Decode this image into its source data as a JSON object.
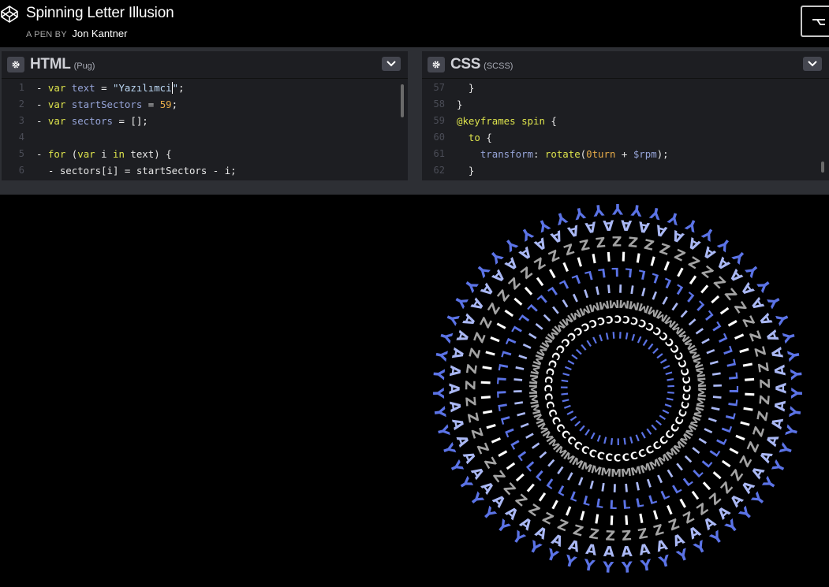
{
  "header": {
    "title": "Spinning Letter Illusion",
    "byline_prefix": "A PEN BY",
    "author": "Jon Kantner"
  },
  "editors": [
    {
      "language": "HTML",
      "preprocessor": "(Pug)",
      "lines": [
        {
          "n": "1",
          "tokens": [
            [
              "op",
              "- "
            ],
            [
              "kw",
              "var "
            ],
            [
              "var",
              "text"
            ],
            [
              "op",
              " = "
            ],
            [
              "str",
              "\"Yazılımci"
            ],
            [
              "cursor",
              ""
            ],
            [
              "str",
              "\""
            ],
            [
              "op",
              ";"
            ]
          ]
        },
        {
          "n": "2",
          "tokens": [
            [
              "op",
              "- "
            ],
            [
              "kw",
              "var "
            ],
            [
              "var",
              "startSectors"
            ],
            [
              "op",
              " = "
            ],
            [
              "num",
              "59"
            ],
            [
              "op",
              ";"
            ]
          ]
        },
        {
          "n": "3",
          "tokens": [
            [
              "op",
              "- "
            ],
            [
              "kw",
              "var "
            ],
            [
              "var",
              "sectors"
            ],
            [
              "op",
              " = [];"
            ]
          ]
        },
        {
          "n": "4",
          "tokens": []
        },
        {
          "n": "5",
          "tokens": [
            [
              "op",
              "- "
            ],
            [
              "kw",
              "for "
            ],
            [
              "op",
              "("
            ],
            [
              "kw",
              "var "
            ],
            [
              "plain",
              "i "
            ],
            [
              "kw",
              "in "
            ],
            [
              "plain",
              "text) {"
            ]
          ]
        },
        {
          "n": "6",
          "tokens": [
            [
              "op",
              "  - "
            ],
            [
              "plain",
              "sectors[i] = startSectors - i;"
            ]
          ]
        }
      ]
    },
    {
      "language": "CSS",
      "preprocessor": "(SCSS)",
      "lines": [
        {
          "n": "57",
          "tokens": [
            [
              "plain",
              "  }"
            ]
          ]
        },
        {
          "n": "58",
          "tokens": [
            [
              "plain",
              "}"
            ]
          ]
        },
        {
          "n": "59",
          "tokens": [
            [
              "at",
              "@keyframes "
            ],
            [
              "sel",
              "spin "
            ],
            [
              "plain",
              "{"
            ]
          ]
        },
        {
          "n": "60",
          "tokens": [
            [
              "sel",
              "  to "
            ],
            [
              "plain",
              "{"
            ]
          ]
        },
        {
          "n": "61",
          "tokens": [
            [
              "prop",
              "    transform"
            ],
            [
              "plain",
              ": "
            ],
            [
              "kw",
              "rotate"
            ],
            [
              "plain",
              "("
            ],
            [
              "num",
              "0turn"
            ],
            [
              "plain",
              " + "
            ],
            [
              "var",
              "$rpm"
            ],
            [
              "plain",
              ");"
            ]
          ]
        },
        {
          "n": "62",
          "tokens": [
            [
              "plain",
              "  }"
            ]
          ]
        }
      ]
    }
  ],
  "preview": {
    "rings": [
      {
        "letter": "Y",
        "count": 59,
        "color": "#5b73e6"
      },
      {
        "letter": "A",
        "count": 58,
        "color": "#aab8f4"
      },
      {
        "letter": "Z",
        "count": 57,
        "color": "#a3a3a3"
      },
      {
        "letter": "I",
        "count": 56,
        "color": "#ffffff"
      },
      {
        "letter": "L",
        "count": 55,
        "color": "#5b73e6"
      },
      {
        "letter": "I",
        "count": 54,
        "color": "#aab8f4"
      },
      {
        "letter": "M",
        "count": 53,
        "color": "#a3a3a3"
      },
      {
        "letter": "C",
        "count": 52,
        "color": "#ffffff"
      },
      {
        "letter": "I",
        "count": 51,
        "color": "#5b73e6"
      }
    ]
  },
  "icons": {
    "logo": "codepen-logo-icon",
    "fork": "fork-icon",
    "settings": "gear-icon",
    "dropdown": "chevron-down-icon"
  }
}
